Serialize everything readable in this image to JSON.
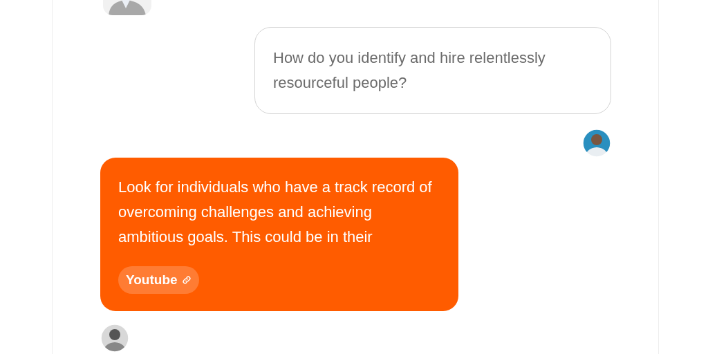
{
  "messages": [
    {
      "kind": "user",
      "text": "How do you identify and hire relentlessly resourceful people?"
    },
    {
      "kind": "assistant",
      "text": "Look for individuals who have a track record of overcoming challenges and achieving ambitious goals. This could be in their",
      "sources": [
        {
          "label": "Youtube"
        }
      ]
    }
  ]
}
